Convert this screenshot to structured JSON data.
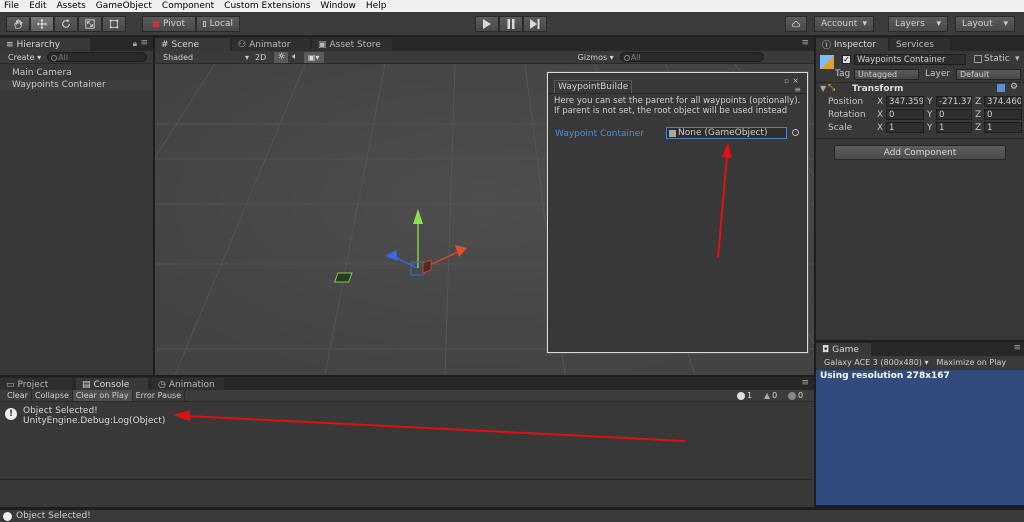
{
  "menu": [
    "File",
    "Edit",
    "Assets",
    "GameObject",
    "Component",
    "Custom Extensions",
    "Window",
    "Help"
  ],
  "toolbar": {
    "pivot": "Pivot",
    "local": "Local",
    "account": "Account",
    "layers": "Layers",
    "layout": "Layout"
  },
  "hierarchy": {
    "tab": "Hierarchy",
    "create": "Create",
    "search_placeholder": "All",
    "items": [
      "Main Camera",
      "Waypoints Container"
    ]
  },
  "scene": {
    "tabs": [
      "Scene",
      "Animator",
      "Asset Store"
    ],
    "shading": "Shaded",
    "mode_2d": "2D",
    "gizmos": "Gizmos",
    "search_placeholder": "All"
  },
  "waypoint_window": {
    "title": "WaypointBuilde",
    "help_text": "Here you can set the parent for all waypoints (optionally). If parent is not set, the root object will be used instead",
    "field_label": "Waypoint Container",
    "field_value": "None (GameObject)"
  },
  "inspector": {
    "tabs": [
      "Inspector",
      "Services"
    ],
    "object_name": "Waypoints Container",
    "static_label": "Static",
    "tag_label": "Tag",
    "tag_value": "Untagged",
    "layer_label": "Layer",
    "layer_value": "Default",
    "component": "Transform",
    "rows": [
      {
        "label": "Position",
        "x": "347.359",
        "y": "-271.37",
        "z": "374.460"
      },
      {
        "label": "Rotation",
        "x": "0",
        "y": "0",
        "z": "0"
      },
      {
        "label": "Scale",
        "x": "1",
        "y": "1",
        "z": "1"
      }
    ],
    "axis_x": "X",
    "axis_y": "Y",
    "axis_z": "Z",
    "add_component": "Add Component"
  },
  "bottom": {
    "tabs": [
      "Project",
      "Console",
      "Animation"
    ],
    "buttons": [
      "Clear",
      "Collapse",
      "Clear on Play",
      "Error Pause"
    ],
    "counts": {
      "info": "1",
      "warn": "0",
      "error": "0"
    },
    "log_line1": "Object Selected!",
    "log_line2": "UnityEngine.Debug:Log(Object)"
  },
  "game": {
    "tab": "Game",
    "device": "Galaxy ACE 3 (800x480)",
    "maximize": "Maximize on Play",
    "resolution_text": "Using resolution 278x167"
  },
  "status": "Object Selected!",
  "colors": {
    "accent_blue": "#4f8fe0",
    "game_bg": "#314b7e",
    "annotation_red": "#e01010"
  }
}
